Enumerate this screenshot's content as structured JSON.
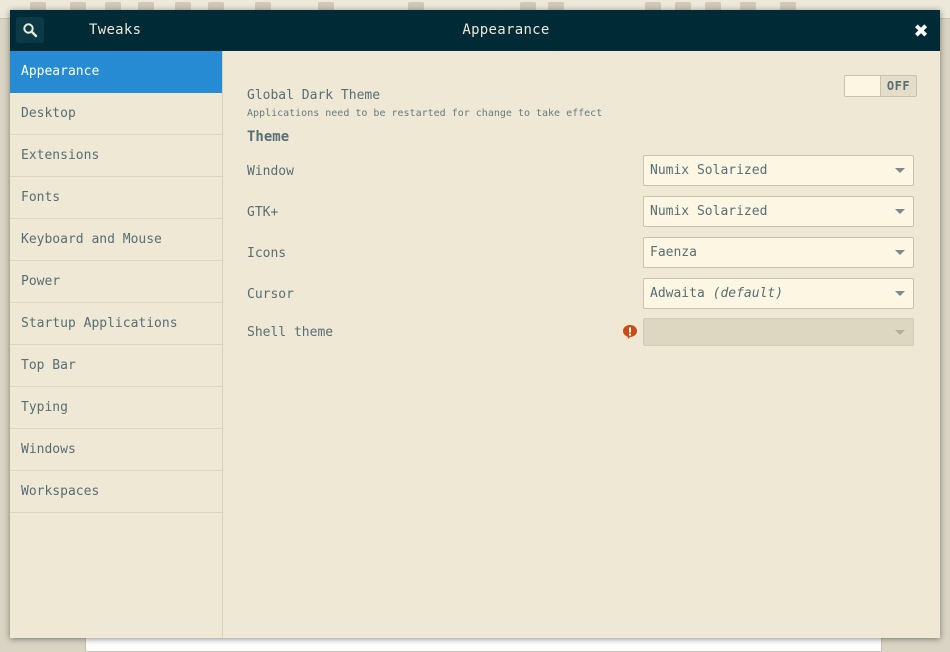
{
  "window": {
    "app_title": "Tweaks",
    "panel_title": "Appearance",
    "close_glyph": "✖"
  },
  "sidebar": {
    "items": [
      {
        "label": "Appearance",
        "active": true
      },
      {
        "label": "Desktop"
      },
      {
        "label": "Extensions"
      },
      {
        "label": "Fonts"
      },
      {
        "label": "Keyboard and Mouse"
      },
      {
        "label": "Power"
      },
      {
        "label": "Startup Applications"
      },
      {
        "label": "Top Bar"
      },
      {
        "label": "Typing"
      },
      {
        "label": "Windows"
      },
      {
        "label": "Workspaces"
      }
    ]
  },
  "appearance": {
    "dark_theme": {
      "label": "Global Dark Theme",
      "note": "Applications need to be restarted for change to take effect",
      "state": "OFF"
    },
    "theme_section": "Theme",
    "rows": {
      "window": {
        "label": "Window",
        "value": "Numix Solarized"
      },
      "gtk": {
        "label": "GTK+",
        "value": "Numix Solarized"
      },
      "icons": {
        "label": "Icons",
        "value": "Faenza"
      },
      "cursor": {
        "label": "Cursor",
        "value": "Adwaita",
        "value_suffix": "(default)"
      },
      "shell": {
        "label": "Shell theme",
        "value": ""
      }
    }
  },
  "colors": {
    "titlebar": "#002b36",
    "accent": "#268bd2",
    "background": "#eee8d5",
    "warning": "#cb4b16"
  },
  "icons": {
    "search": "search-icon",
    "close": "close-icon",
    "warning": "warning-icon",
    "dropdown": "chevron-down-icon"
  }
}
